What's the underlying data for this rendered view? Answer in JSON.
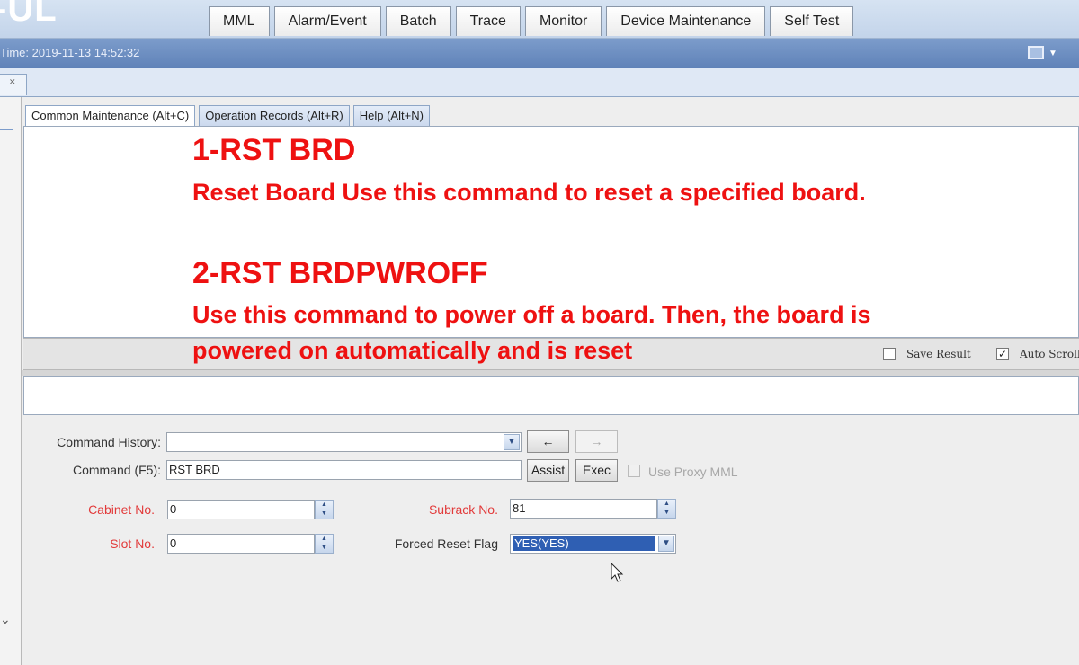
{
  "app": {
    "logo_text": "-UL"
  },
  "top_tabs": [
    "MML",
    "Alarm/Event",
    "Batch",
    "Trace",
    "Monitor",
    "Device Maintenance",
    "Self Test"
  ],
  "status": {
    "time": "Time: 2019-11-13 14:52:32"
  },
  "sub_tabs": [
    {
      "label": "Common Maintenance (Alt+C)",
      "active": true
    },
    {
      "label": "Operation Records (Alt+R)",
      "active": false
    },
    {
      "label": "Help (Alt+N)",
      "active": false
    }
  ],
  "annotation": {
    "heading1": "1-RST BRD",
    "text1": "Reset Board Use this command to reset a specified board.",
    "heading2": "2-RST BRDPWROFF",
    "text2_line1": "Use this command to power off a board. Then, the board is",
    "text2_line2": "powered on automatically and is reset"
  },
  "output_options": {
    "save_result_label": "Save Result",
    "save_result_checked": false,
    "auto_scroll_label": "Auto Scroll",
    "auto_scroll_checked": true
  },
  "form": {
    "command_history_label": "Command History:",
    "command_history_value": "",
    "back_arrow": "←",
    "forward_arrow": "→",
    "command_label": "Command (F5):",
    "command_value": "RST BRD",
    "assist_label": "Assist",
    "exec_label": "Exec",
    "use_proxy_label": "Use Proxy MML",
    "use_proxy_checked": false,
    "cabinet_label": "Cabinet No.",
    "cabinet_value": "0",
    "subrack_label": "Subrack No.",
    "subrack_value": "81",
    "slot_label": "Slot No.",
    "slot_value": "0",
    "forced_reset_label": "Forced Reset Flag",
    "forced_reset_value": "YES(YES)"
  },
  "colors": {
    "annotation": "#ee1111",
    "required_label": "#e23a3a",
    "selection": "#2f5fb3",
    "title_bar": "#6f8fc2"
  }
}
